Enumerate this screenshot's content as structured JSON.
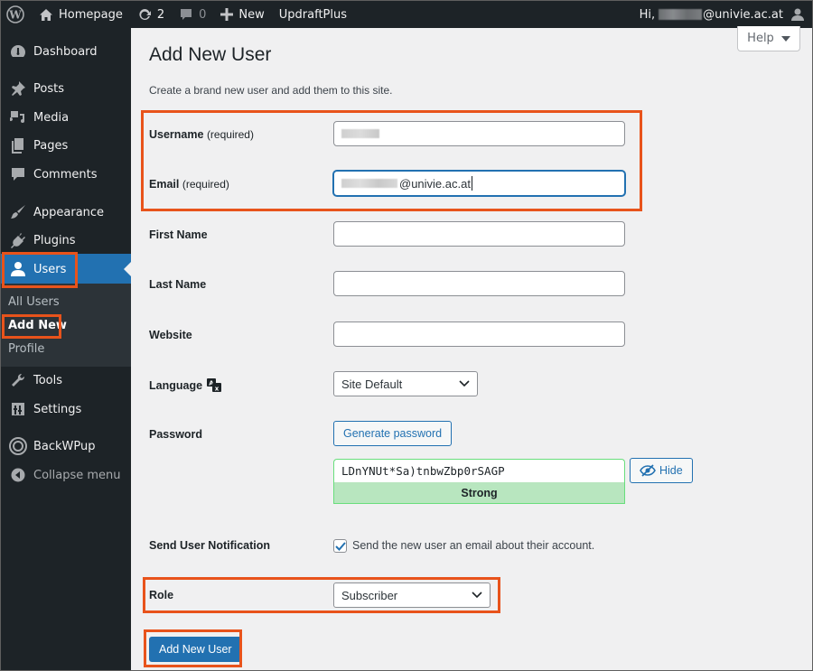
{
  "adminbar": {
    "site_name": "Homepage",
    "updates_count": "2",
    "comments_count": "0",
    "new_label": "New",
    "plugin_label": "UpdraftPlus",
    "greeting": "Hi,",
    "user_email_suffix": "@univie.ac.at"
  },
  "sidebar": {
    "items": [
      {
        "label": "Dashboard",
        "icon": "dashboard-icon"
      },
      {
        "label": "Posts",
        "icon": "pin-icon"
      },
      {
        "label": "Media",
        "icon": "media-icon"
      },
      {
        "label": "Pages",
        "icon": "pages-icon"
      },
      {
        "label": "Comments",
        "icon": "comment-icon"
      },
      {
        "label": "Appearance",
        "icon": "paintbrush-icon"
      },
      {
        "label": "Plugins",
        "icon": "plug-icon"
      },
      {
        "label": "Users",
        "icon": "user-icon",
        "active": true
      },
      {
        "label": "Tools",
        "icon": "wrench-icon"
      },
      {
        "label": "Settings",
        "icon": "settings-icon"
      },
      {
        "label": "BackWPup",
        "icon": "backwpup-icon"
      },
      {
        "label": "Collapse menu",
        "icon": "collapse-icon"
      }
    ],
    "submenu": [
      {
        "label": "All Users"
      },
      {
        "label": "Add New",
        "current": true
      },
      {
        "label": "Profile"
      }
    ]
  },
  "help": {
    "label": "Help"
  },
  "page": {
    "title": "Add New User",
    "description": "Create a brand new user and add them to this site."
  },
  "form": {
    "username": {
      "label": "Username",
      "required": "(required)",
      "value_visible": ""
    },
    "email": {
      "label": "Email",
      "required": "(required)",
      "value_suffix": "@univie.ac.at"
    },
    "first_name": {
      "label": "First Name",
      "value": ""
    },
    "last_name": {
      "label": "Last Name",
      "value": ""
    },
    "website": {
      "label": "Website",
      "value": ""
    },
    "language": {
      "label": "Language",
      "selected": "Site Default"
    },
    "password": {
      "label": "Password",
      "generate_label": "Generate password",
      "value": "LDnYNUt*Sa)tnbwZbp0rSAGP",
      "strength": "Strong",
      "hide_label": "Hide"
    },
    "notification": {
      "label": "Send User Notification",
      "checkbox_label": "Send the new user an email about their account.",
      "checked": true
    },
    "role": {
      "label": "Role",
      "selected": "Subscriber"
    },
    "submit_label": "Add New User"
  },
  "colors": {
    "accent": "#2271b1",
    "admin_bar": "#1d2327",
    "highlight": "#e8531b",
    "strength_bg": "#b8e6bf"
  }
}
